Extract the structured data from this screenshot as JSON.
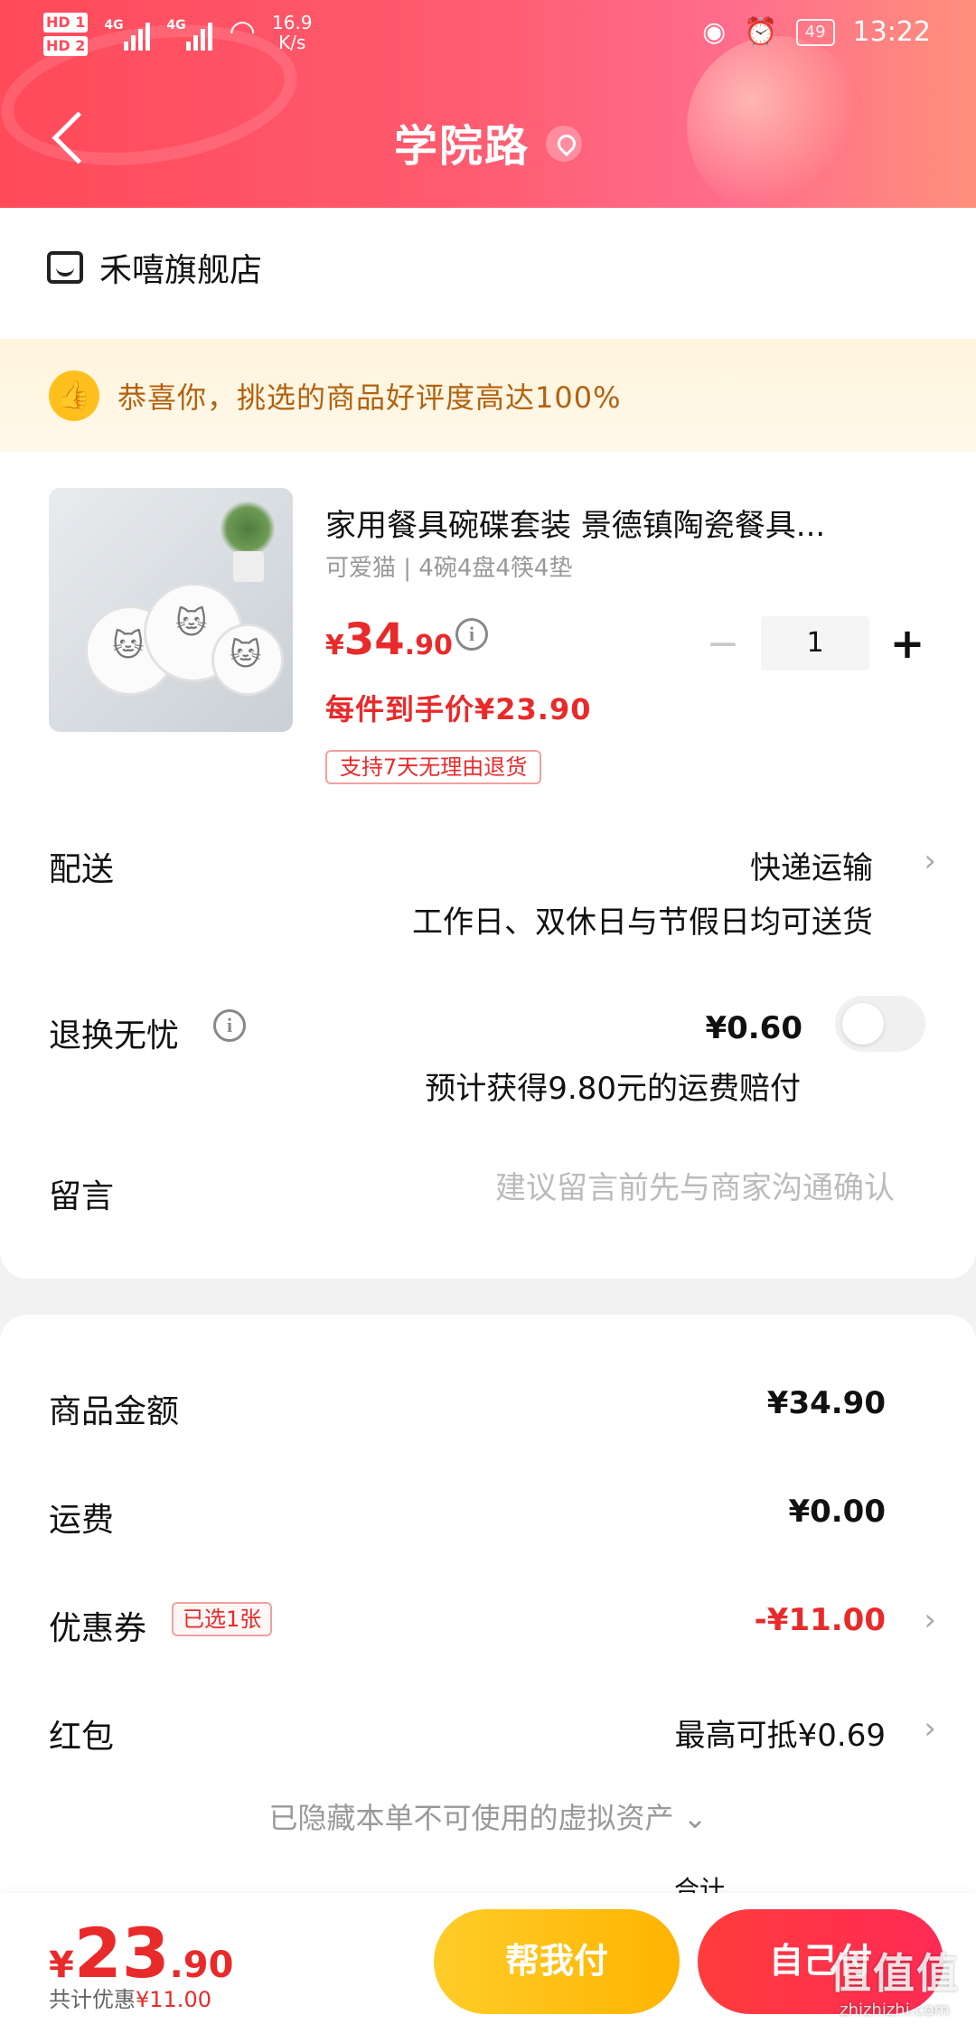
{
  "status_bar": {
    "hd1": "HD 1",
    "hd2": "HD 2",
    "sig1_label": "4G",
    "sig2_label": "4G",
    "speed_value": "16.9",
    "speed_unit": "K/s",
    "battery": "49",
    "time": "13:22"
  },
  "header": {
    "title": "学院路"
  },
  "shop": {
    "name": "禾嘻旗舰店"
  },
  "praise": {
    "text": "恭喜你，挑选的商品好评度高达100%"
  },
  "product": {
    "title": "家用餐具碗碟套装 景德镇陶瓷餐具...",
    "spec": "可爱猫 | 4碗4盘4筷4垫",
    "price_symbol": "¥",
    "price_int": "34",
    "price_dec": ".90",
    "after_price": "每件到手价¥23.90",
    "return_tag": "支持7天无理由退货",
    "quantity": "1",
    "minus": "−",
    "plus": "+"
  },
  "delivery": {
    "label": "配送",
    "value": "快递运输",
    "note": "工作日、双休日与节假日均可送货"
  },
  "return_worry_free": {
    "label": "退换无忧",
    "price": "¥0.60",
    "note": "预计获得9.80元的运费赔付"
  },
  "message": {
    "label": "留言",
    "placeholder": "建议留言前先与商家沟通确认"
  },
  "summary": {
    "goods_label": "商品金额",
    "goods_value": "¥34.90",
    "shipping_label": "运费",
    "shipping_value": "¥0.00",
    "coupon_label": "优惠券",
    "coupon_tag": "已选1张",
    "coupon_value": "-¥11.00",
    "redpacket_label": "红包",
    "redpacket_value": "最高可抵¥0.69",
    "hidden_assets": "已隐藏本单不可使用的虚拟资产 ⌄"
  },
  "bottom": {
    "total_symbol": "¥",
    "total_int": "23",
    "total_dec": ".90",
    "discount_label": "共计优惠",
    "discount_value": "¥11.00",
    "help_pay": "帮我付",
    "self_pay": "自己付",
    "partial_text": "合计"
  },
  "watermark": {
    "mark": "值值值",
    "site": "zhizhizhi.com"
  },
  "colors": {
    "accent_red": "#e92a2a",
    "header_start": "#ff4a5a",
    "help_btn": "#ffb400",
    "praise_text": "#b2620f"
  }
}
